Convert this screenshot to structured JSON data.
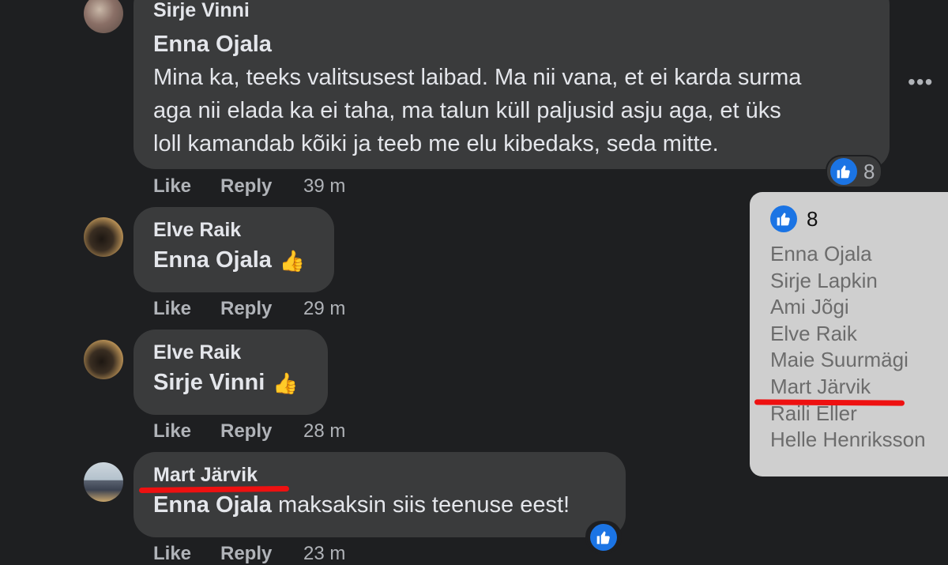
{
  "comments": [
    {
      "author": "Sirje Vinni",
      "tagged": "Enna Ojala",
      "lines": [
        "Mina ka, teeks valitsusest laibad. Ma nii vana, et ei karda surma",
        "aga nii elada ka ei taha, ma talun küll paljusid asju aga, et üks",
        "loll kamandab kõiki ja teeb me elu kibedaks, seda mitte."
      ],
      "like": "Like",
      "reply": "Reply",
      "time": "39 m",
      "reaction_count": "8"
    },
    {
      "author": "Elve Raik",
      "tagged": "Enna Ojala",
      "emoji": "👍",
      "like": "Like",
      "reply": "Reply",
      "time": "29 m"
    },
    {
      "author": "Elve Raik",
      "tagged": "Sirje Vinni",
      "emoji": "👍",
      "like": "Like",
      "reply": "Reply",
      "time": "28 m"
    },
    {
      "author": "Mart Järvik",
      "tagged": "Enna Ojala",
      "text": " maksaksin siis teenuse eest!",
      "like": "Like",
      "reply": "Reply",
      "time": "23 m"
    }
  ],
  "more_options": "•••",
  "reactions_popup": {
    "count": "8",
    "names": [
      "Enna Ojala",
      "Sirje Lapkin",
      "Ami Jõgi",
      "Elve Raik",
      "Maie Suurmägi",
      "Mart Järvik",
      "Raili Eller",
      "Helle Henriksson"
    ]
  },
  "icons": {
    "like": "thumbs-up-icon",
    "more": "more-options-icon"
  },
  "colors": {
    "background": "#1e1f21",
    "bubble": "#3a3b3c",
    "like_blue": "#1b74e4",
    "highlight_red": "#ee1111",
    "popup_bg": "#cfcfcf"
  }
}
